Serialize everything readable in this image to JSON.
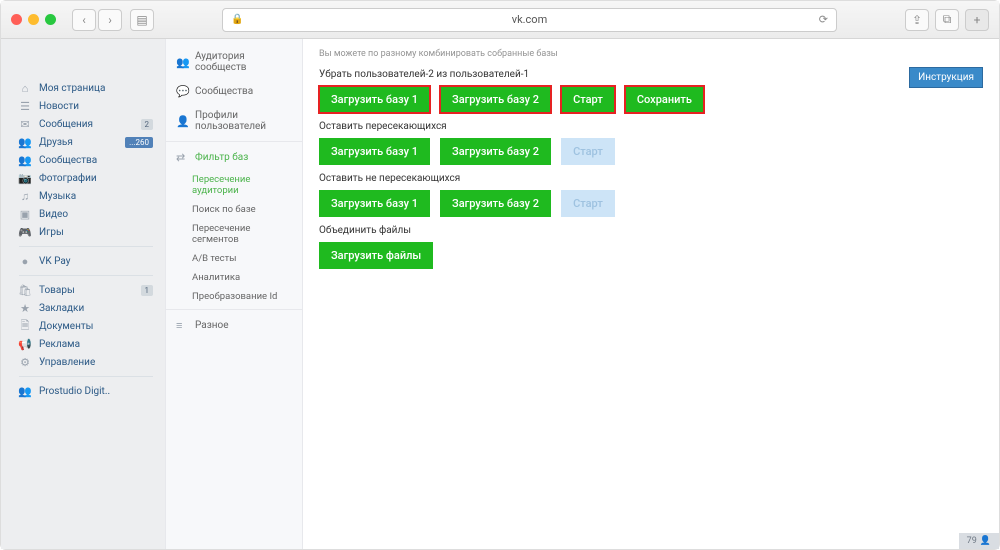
{
  "browser": {
    "url": "vk.com"
  },
  "leftMenu": {
    "items": [
      {
        "icon": "⌂",
        "label": "Моя страница"
      },
      {
        "icon": "☰",
        "label": "Новости"
      },
      {
        "icon": "✉",
        "label": "Сообщения",
        "badge": "2"
      },
      {
        "icon": "👥",
        "label": "Друзья",
        "badge": "...260",
        "badgeBlue": true
      },
      {
        "icon": "👥",
        "label": "Сообщества"
      },
      {
        "icon": "📷",
        "label": "Фотографии"
      },
      {
        "icon": "♫",
        "label": "Музыка"
      },
      {
        "icon": "▣",
        "label": "Видео"
      },
      {
        "icon": "🎮",
        "label": "Игры"
      }
    ],
    "pay": {
      "icon": "●",
      "label": "VK Pay"
    },
    "extra": [
      {
        "icon": "🛍",
        "label": "Товары",
        "badge": "1"
      },
      {
        "icon": "★",
        "label": "Закладки"
      },
      {
        "icon": "🗎",
        "label": "Документы"
      },
      {
        "icon": "📢",
        "label": "Реклама"
      },
      {
        "icon": "⚙",
        "label": "Управление"
      }
    ],
    "prostudio": {
      "icon": "👥",
      "label": "Prostudio Digit.."
    }
  },
  "midMenu": {
    "top": [
      {
        "icon": "👥",
        "label": "Аудитория сообществ"
      },
      {
        "icon": "💬",
        "label": "Сообщества"
      },
      {
        "icon": "👤",
        "label": "Профили пользователей"
      }
    ],
    "filter": {
      "icon": "⇄",
      "label": "Фильтр баз"
    },
    "subs": [
      {
        "label": "Пересечение аудитории",
        "sel": true
      },
      {
        "label": "Поиск по базе"
      },
      {
        "label": "Пересечение сегментов"
      },
      {
        "label": "A/B тесты"
      },
      {
        "label": "Аналитика"
      },
      {
        "label": "Преобразование Id"
      }
    ],
    "other": {
      "icon": "≡",
      "label": "Разное"
    }
  },
  "main": {
    "hint": "Вы можете по разному комбинировать собранные базы",
    "instruction": "Инструкция",
    "sections": [
      {
        "label": "Убрать пользователей-2 из пользователей-1",
        "buttons": [
          {
            "text": "Загрузить базу 1",
            "hl": true
          },
          {
            "text": "Загрузить базу 2",
            "hl": true
          },
          {
            "text": "Старт",
            "hl": true
          },
          {
            "text": "Сохранить",
            "hl": true
          }
        ]
      },
      {
        "label": "Оставить пересекающихся",
        "buttons": [
          {
            "text": "Загрузить базу 1"
          },
          {
            "text": "Загрузить базу 2"
          },
          {
            "text": "Старт",
            "disabled": true
          }
        ]
      },
      {
        "label": "Оставить не пересекающихся",
        "buttons": [
          {
            "text": "Загрузить базу 1"
          },
          {
            "text": "Загрузить базу 2"
          },
          {
            "text": "Старт",
            "disabled": true
          }
        ]
      },
      {
        "label": "Объединить файлы",
        "buttons": [
          {
            "text": "Загрузить файлы"
          }
        ]
      }
    ]
  },
  "footerBadge": {
    "count": "79",
    "icon": "👤"
  }
}
